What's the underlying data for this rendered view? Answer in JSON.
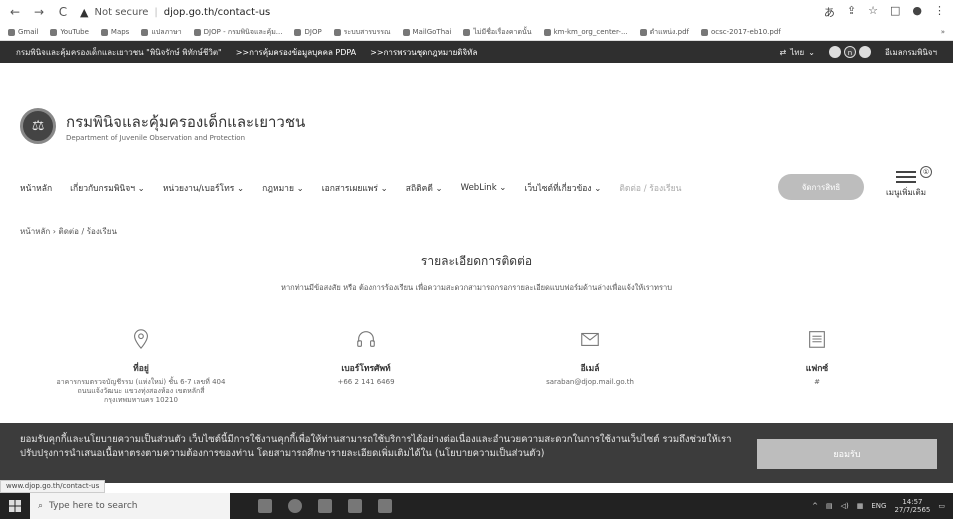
{
  "browser": {
    "security": "Not secure",
    "url": "djop.go.th/contact-us",
    "bookmarks": [
      "Gmail",
      "YouTube",
      "Maps",
      "แปลภาษา",
      "DJOP - กรมพินิจและคุ้ม...",
      "DJOP",
      "ระบบสารบรรณ",
      "MailGoThai",
      "ไม่มีชื่อเรื่องคาดนั้น",
      "km-km_org_center-...",
      "ตำแหน่ง.pdf",
      "ocsc-2017-eb10.pdf"
    ],
    "more_bookmarks": "»"
  },
  "topbar": {
    "left_text": "กรมพินิจและคุ้มครองเด็กและเยาวชน \"พินิจรักษ์ พิทักษ์ชีวิต\"",
    "link1": ">>การคุ้มครองข้อมูลบุคคล PDPA",
    "link2": ">>การพรวนชุดกฎหมายดิจิทัล",
    "language": "ไทย",
    "site_link": "อีเมลกรมพินิจฯ"
  },
  "header": {
    "org_name_th": "กรมพินิจและคุ้มครองเด็กและเยาวชน",
    "org_name_en": "Department of Juvenile Observation and Protection"
  },
  "menu": {
    "items": [
      "หน้าหลัก",
      "เกี่ยวกับกรมพินิจฯ ⌄",
      "หน่วยงาน/เบอร์โทร ⌄",
      "กฎหมาย ⌄",
      "เอกสารเผยแพร่ ⌄",
      "สถิติคดี ⌄",
      "WebLink ⌄",
      "เว็บไซต์ที่เกี่ยวข้อง ⌄"
    ],
    "contact": "ติดต่อ / ร้องเรียน",
    "search_button": "จัดการสิทธิ",
    "more": "เมนูเพิ่มเติม",
    "badge": "①"
  },
  "breadcrumb": "หน้าหลัก  ›  ติดต่อ / ร้องเรียน",
  "page": {
    "title": "รายละเอียดการติดต่อ",
    "subtitle": "หากท่านมีข้อสงสัย หรือ ต้องการร้องเรียน เพื่อความสะดวกสามารถกรอกรายละเอียดแบบฟอร์มด้านล่างเพื่อแจ้งให้เราทราบ"
  },
  "contacts": [
    {
      "label": "ที่อยู่",
      "lines": [
        "อาคารกรมตรวจบัญชีรรม (แห่งใหม่) ชั้น 6-7 เลขที่ 404",
        "ถนนแจ้งวัฒนะ แขวงทุ่งสองห้อง เขตหลักสี่",
        "กรุงเทพมหานคร 10210"
      ]
    },
    {
      "label": "เบอร์โทรศัพท์",
      "lines": [
        "+66 2 141 6469"
      ]
    },
    {
      "label": "อีเมล์",
      "lines": [
        "saraban@djop.mail.go.th"
      ]
    },
    {
      "label": "แฟกซ์",
      "lines": [
        "#"
      ]
    }
  ],
  "cookie": {
    "text": "ยอมรับคุกกี้และนโยบายความเป็นส่วนตัว เว็บไซต์นี้มีการใช้งานคุกกี้เพื่อให้ท่านสามารถใช้บริการได้อย่างต่อเนื่องและอำนวยความสะดวกในการใช้งานเว็บไซต์ รวมถึงช่วยให้เราปรับปรุงการนำเสนอเนื้อหาตรงตามความต้องการของท่าน โดยสามารถศึกษารายละเอียดเพิ่มเติมได้ใน (นโยบายความเป็นส่วนตัว)",
    "accept": "ยอมรับ"
  },
  "status_url": "www.djop.go.th/contact-us",
  "taskbar": {
    "search_placeholder": "Type here to search",
    "lang": "ENG",
    "time": "14:57",
    "date": "27/7/2565"
  }
}
